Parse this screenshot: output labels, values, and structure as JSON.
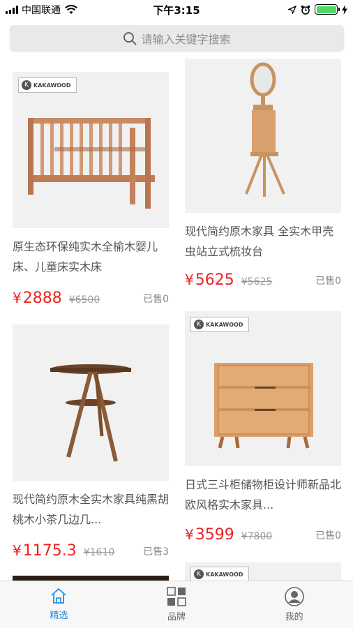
{
  "status_bar": {
    "carrier": "中国联通",
    "time": "下午3:15",
    "battery_level": 1.0
  },
  "search": {
    "placeholder": "请输入关键字搜索",
    "icon": "search-icon"
  },
  "products": [
    {
      "title": "原生态环保纯实木全榆木婴儿床、儿童床实木床",
      "currency": "¥",
      "price": "2888",
      "original_price": "¥6500",
      "sold": "已售0",
      "brand_tag": "KAKAWOOD",
      "image": "wooden-crib"
    },
    {
      "title": "现代简约原木家具 全实木甲壳虫站立式梳妆台",
      "currency": "¥",
      "price": "5625",
      "original_price": "¥5625",
      "sold": "已售0",
      "image": "standing-vanity-mirror"
    },
    {
      "title": "现代简约原木全实木家具纯黑胡桃木小茶几边几...",
      "currency": "¥",
      "price": "1175.3",
      "original_price": "¥1610",
      "sold": "已售3",
      "image": "walnut-side-table"
    },
    {
      "title": "日式三斗柜储物柜设计师新品北欧风格实木家具...",
      "currency": "¥",
      "price": "3599",
      "original_price": "¥7800",
      "sold": "已售0",
      "brand_tag": "KAKAWOOD",
      "image": "three-drawer-chest"
    }
  ],
  "tabbar": {
    "items": [
      {
        "label": "精选",
        "icon": "home-icon",
        "active": true
      },
      {
        "label": "品牌",
        "icon": "grid-icon",
        "active": false
      },
      {
        "label": "我的",
        "icon": "user-icon",
        "active": false
      }
    ]
  },
  "colors": {
    "price": "#ee2222",
    "tab_active": "#1a8fe3",
    "search_bg": "#e9e9ea"
  }
}
